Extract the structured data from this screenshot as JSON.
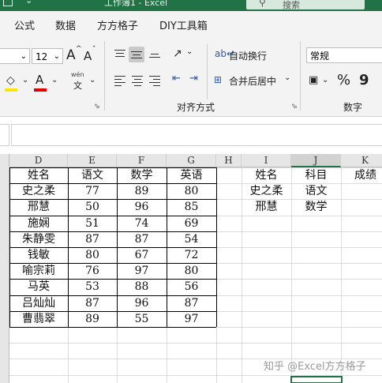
{
  "window": {
    "title": "工作簿1 - Excel",
    "search_label": "搜索"
  },
  "tabs": [
    "公式",
    "数据",
    "方方格子",
    "DIY工具箱"
  ],
  "ribbon": {
    "font_size": "12",
    "grow_font": "A",
    "shrink_font": "A",
    "wen_label": "wén",
    "wen_char": "文",
    "wrap_text": "自动换行",
    "merge_center": "合并后居中",
    "alignment_group": "对齐方式",
    "number_format": "常规",
    "percent": "%",
    "comma": "9",
    "number_group": "数字"
  },
  "grid": {
    "columns": [
      "D",
      "E",
      "F",
      "G",
      "H",
      "I",
      "J",
      "K"
    ],
    "left_table": {
      "headers": [
        "姓名",
        "语文",
        "数学",
        "英语"
      ],
      "rows": [
        [
          "史之柔",
          "77",
          "89",
          "80"
        ],
        [
          "邢慧",
          "50",
          "96",
          "85"
        ],
        [
          "施娴",
          "51",
          "74",
          "69"
        ],
        [
          "朱静雯",
          "87",
          "87",
          "54"
        ],
        [
          "钱敏",
          "80",
          "67",
          "72"
        ],
        [
          "喻宗莉",
          "76",
          "97",
          "80"
        ],
        [
          "马英",
          "53",
          "88",
          "56"
        ],
        [
          "吕灿灿",
          "87",
          "96",
          "87"
        ],
        [
          "曹翡翠",
          "89",
          "55",
          "97"
        ]
      ]
    },
    "right_table": {
      "headers": [
        "姓名",
        "科目",
        "成绩"
      ],
      "rows": [
        [
          "史之柔",
          "语文",
          ""
        ],
        [
          "邢慧",
          "数学",
          ""
        ]
      ]
    }
  },
  "watermark": "知乎 @Excel方方格子",
  "colors": {
    "brand_green": "#217346",
    "font_color_red": "#e00000",
    "highlight_yellow": "#ffe600"
  }
}
